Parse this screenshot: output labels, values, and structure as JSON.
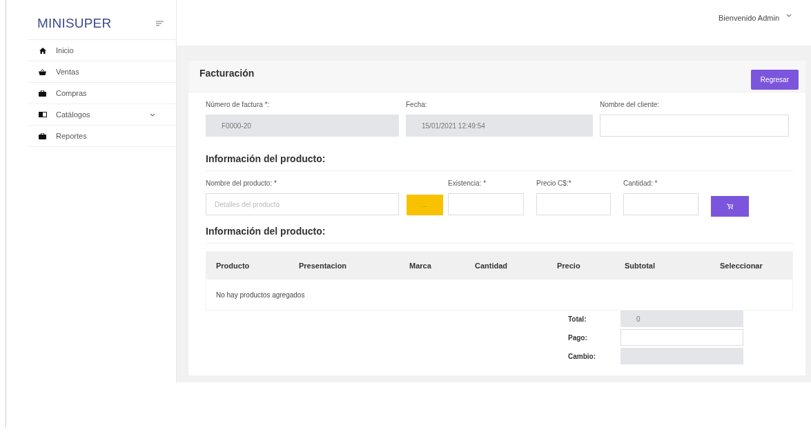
{
  "sidebar": {
    "brand": "MINISUPER",
    "items": [
      {
        "label": "Inicio",
        "expandable": false
      },
      {
        "label": "Ventas",
        "expandable": false
      },
      {
        "label": "Compras",
        "expandable": false
      },
      {
        "label": "Catálogos",
        "expandable": true
      },
      {
        "label": "Reportes",
        "expandable": false
      }
    ]
  },
  "header": {
    "user_menu": "Bienvenido Admin"
  },
  "page": {
    "title": "Facturación",
    "back_button": "Regresar"
  },
  "invoice_fields": [
    {
      "label": "Número de factura *:",
      "value": "F0000-20",
      "disabled": true
    },
    {
      "label": "Fecha:",
      "value": "15/01/2021 12:49:54",
      "disabled": true
    },
    {
      "label": "Nombre del cliente:",
      "disabled": false
    }
  ],
  "product_section": {
    "heading": "Información del producto:",
    "search_button": "...",
    "fields": [
      {
        "label": "Nombre del producto: *",
        "placeholder": "Detalles del producto"
      },
      {
        "label": "Existencia: *"
      },
      {
        "label": "Precio C$:*"
      },
      {
        "label": "Cantidad: *"
      }
    ]
  },
  "table": {
    "heading": "Información del producto:",
    "columns": [
      "Producto",
      "Presentacion",
      "Marca",
      "Cantidad",
      "Precio",
      "Subtotal",
      "Seleccionar"
    ],
    "empty_message": "No hay productos agregados"
  },
  "totals": [
    {
      "label": "Total:",
      "value": "0",
      "disabled": true
    },
    {
      "label": "Pago:",
      "disabled": false
    },
    {
      "label": "Cambio:",
      "disabled": true
    }
  ]
}
